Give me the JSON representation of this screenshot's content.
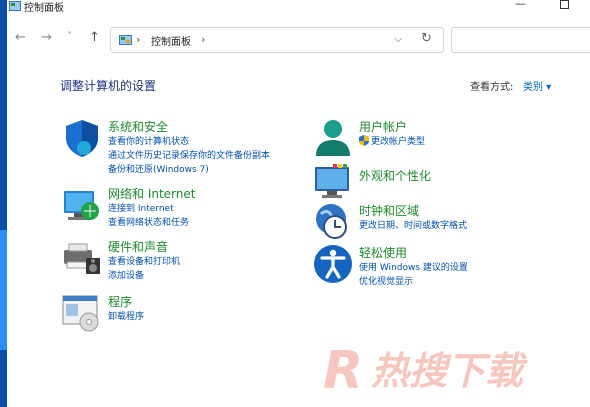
{
  "window": {
    "title": "控制面板"
  },
  "nav": {
    "back_icon": "←",
    "forward_icon": "→",
    "recent_icon": "˅",
    "up_icon": "↑",
    "address_root": "›",
    "address_text": "控制面板",
    "address_sep": "›",
    "address_dropdown_icon": "⌵",
    "refresh_icon": "↻"
  },
  "main": {
    "heading": "调整计算机的设置",
    "view_label": "查看方式:",
    "view_value": "类别 ▾"
  },
  "categories": [
    {
      "title": "系统和安全",
      "icon": "shield-icon",
      "links": [
        "查看你的计算机状态",
        "通过文件历史记录保存你的文件备份副本",
        "备份和还原(Windows 7)"
      ]
    },
    {
      "title": "网络和 Internet",
      "icon": "network-icon",
      "links": [
        "连接到 Internet",
        "查看网络状态和任务"
      ]
    },
    {
      "title": "硬件和声音",
      "icon": "printer-icon",
      "links": [
        "查看设备和打印机",
        "添加设备"
      ]
    },
    {
      "title": "程序",
      "icon": "programs-icon",
      "links": [
        "卸载程序"
      ]
    },
    {
      "title": "用户帐户",
      "icon": "user-icon",
      "links": [
        "更改帐户类型"
      ]
    },
    {
      "title": "外观和个性化",
      "icon": "appearance-icon",
      "links": []
    },
    {
      "title": "时钟和区域",
      "icon": "clock-icon",
      "links": [
        "更改日期、时间或数字格式"
      ]
    },
    {
      "title": "轻松使用",
      "icon": "accessibility-icon",
      "links": [
        "使用 Windows 建议的设置",
        "优化视觉显示"
      ]
    }
  ],
  "colors": {
    "heading": "#1e3287",
    "category_title": "#1d8a2b",
    "link": "#0050b3",
    "watermark": "#e8402f"
  }
}
